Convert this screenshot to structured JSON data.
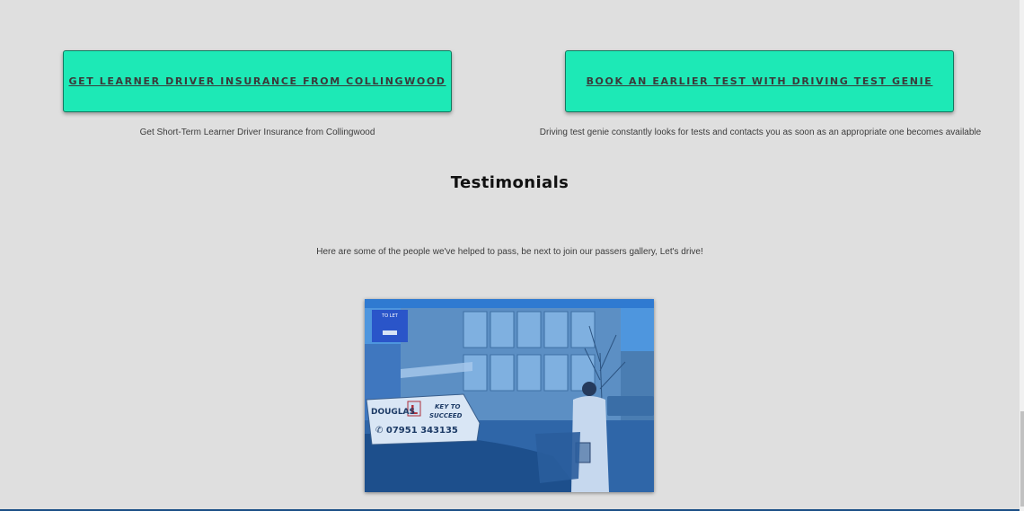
{
  "buttons": {
    "insurance_label": "Get Learner Driver Insurance from Collingwood",
    "test_genie_label": "Book an Earlier Test with Driving Test Genie"
  },
  "captions": {
    "insurance": "Get Short-Term Learner Driver Insurance from Collingwood",
    "test_genie": "Driving test genie constantly looks for tests and contacts you as soon as an appropriate one becomes available"
  },
  "testimonials": {
    "heading": "Testimonials",
    "intro": "Here are some of the people we've helped to pass, be next to join our passers gallery, Let's drive!"
  },
  "photo": {
    "sign_line1": "DOUGLAS",
    "sign_line2": "KEY TO",
    "sign_line3": "SUCCEED",
    "sign_phone": "✆ 07951 343135",
    "board_text": "TO LET"
  },
  "colors": {
    "accent": "#1de9b6",
    "background": "#dfdfdf",
    "photo_tint": "#2d6fb6"
  }
}
